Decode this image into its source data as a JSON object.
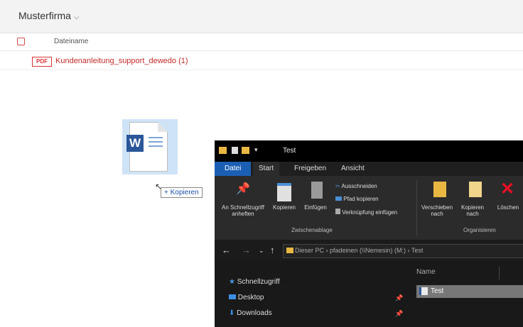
{
  "topbar": {
    "folder": "Musterfirma",
    "chevron": "⌵"
  },
  "list": {
    "header": "Dateiname",
    "rows": [
      {
        "type": "PDF",
        "name": "Kundenanleitung_support_dewedo (1)"
      }
    ]
  },
  "drag": {
    "tooltip": "+ Kopieren"
  },
  "explorer": {
    "title": "Test",
    "tabs": [
      "Datei",
      "Start",
      "Freigeben",
      "Ansicht"
    ],
    "ribbon": {
      "pin_label": "An Schnellzugriff anheften",
      "copy_label": "Kopieren",
      "paste_label": "Einfügen",
      "cut_label": "Ausschneiden",
      "copypath_label": "Pfad kopieren",
      "shortcut_label": "Verknüpfung einfügen",
      "clipboard_group": "Zwischenablage",
      "moveto_label": "Verschieben nach",
      "copyto_label": "Kopieren nach",
      "delete_label": "Löschen",
      "organize_group": "Organisieren"
    },
    "address": "Dieser PC › pfadeinen (\\\\Nemesin) (M:) › Test",
    "nav": [
      {
        "label": "Schnellzugriff",
        "pinned": false
      },
      {
        "label": "Desktop",
        "pinned": true
      },
      {
        "label": "Downloads",
        "pinned": true
      }
    ],
    "column_name": "Name",
    "files": [
      {
        "name": "Test"
      }
    ]
  }
}
